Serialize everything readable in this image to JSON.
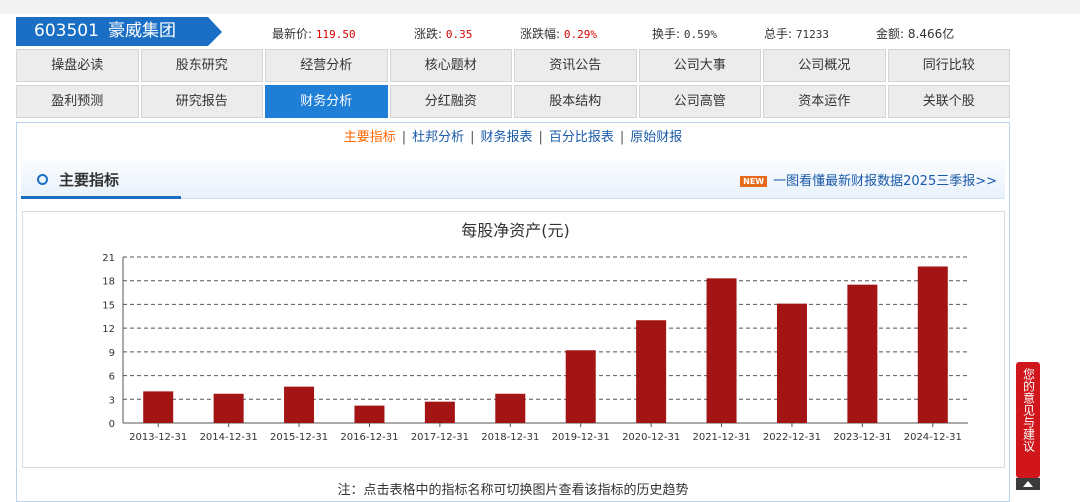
{
  "stock": {
    "code": "603501",
    "name": "豪威集团",
    "latest_label": "最新价:",
    "latest_value": "119.50",
    "change_label": "涨跌:",
    "change_value": "0.35",
    "pct_label": "涨跌幅:",
    "pct_value": "0.29%",
    "turnover_label": "换手:",
    "turnover_value": "0.59%",
    "volume_label": "总手:",
    "volume_value": "71233",
    "amount_label": "金额:",
    "amount_value": "8.466亿"
  },
  "nav_row1": [
    "操盘必读",
    "股东研究",
    "经营分析",
    "核心题材",
    "资讯公告",
    "公司大事",
    "公司概况",
    "同行比较"
  ],
  "nav_row2": [
    "盈利预测",
    "研究报告",
    "财务分析",
    "分红融资",
    "股本结构",
    "公司高管",
    "资本运作",
    "关联个股"
  ],
  "active_tab": "财务分析",
  "subnav": {
    "items": [
      "主要指标",
      "杜邦分析",
      "财务报表",
      "百分比报表",
      "原始财报"
    ],
    "current": "主要指标"
  },
  "section": {
    "title": "主要指标",
    "badge": "NEW",
    "promo": "一图看懂最新财报数据2025三季报>>"
  },
  "chart_data": {
    "type": "bar",
    "title": "每股净资产(元)",
    "categories": [
      "2013-12-31",
      "2014-12-31",
      "2015-12-31",
      "2016-12-31",
      "2017-12-31",
      "2018-12-31",
      "2019-12-31",
      "2020-12-31",
      "2021-12-31",
      "2022-12-31",
      "2023-12-31",
      "2024-12-31"
    ],
    "values": [
      4.0,
      3.7,
      4.6,
      2.2,
      2.7,
      3.7,
      9.2,
      13.0,
      18.3,
      15.1,
      17.5,
      19.8
    ],
    "yticks": [
      0,
      3,
      6,
      9,
      12,
      15,
      18,
      21
    ],
    "ylim": [
      0,
      21
    ],
    "bar_color": "#a31515",
    "grid": "dashed"
  },
  "note": "注：点击表格中的指标名称可切换图片查看该指标的历史趋势",
  "feedback": "您的意见与建议"
}
